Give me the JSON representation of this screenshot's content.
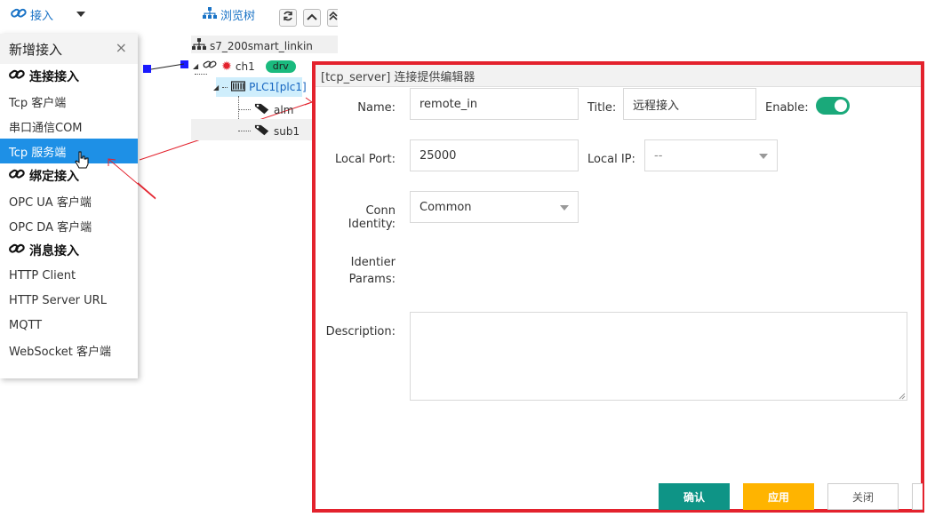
{
  "toolbar": {
    "connect_label": "接入",
    "browse_label": "浏览树"
  },
  "menu": {
    "title": "新增接入",
    "close": "×",
    "sections": [
      {
        "title": "连接接入",
        "items": [
          "Tcp 客户端",
          "串口通信COM",
          "Tcp 服务端"
        ]
      },
      {
        "title": "绑定接入",
        "items": [
          "OPC UA 客户端",
          "OPC DA 客户端"
        ]
      },
      {
        "title": "消息接入",
        "items": [
          "HTTP Client",
          "HTTP Server URL",
          "MQTT",
          "WebSocket 客户端"
        ]
      }
    ],
    "selected": "Tcp 服务端"
  },
  "tree": {
    "root": "s7_200smart_linkin",
    "channel": "ch1",
    "channel_badge": "drv",
    "device": "PLC1[plc1]",
    "tags": [
      "alm",
      "sub1"
    ]
  },
  "editor": {
    "title": "[tcp_server] 连接提供编辑器",
    "name_label": "Name:",
    "name_value": "remote_in",
    "title_label": "Title:",
    "title_value": "远程接入",
    "enable_label": "Enable:",
    "enabled": true,
    "local_port_label": "Local Port:",
    "local_port_value": "25000",
    "local_ip_label": "Local IP:",
    "local_ip_value": "--",
    "conn_identity_label": "Conn Identity:",
    "conn_identity_value": "Common",
    "identier_label_1": "Identier",
    "identier_label_2": "Params:",
    "description_label": "Description:",
    "description_value": "",
    "ok_label": "确认",
    "apply_label": "应用",
    "close_label": "关闭"
  },
  "colors": {
    "accent_blue": "#1e90e6",
    "highlight_red": "#e3222d",
    "ok_green": "#0e9486",
    "apply_yellow": "#ffb400",
    "toggle_green": "#1aa97a"
  }
}
